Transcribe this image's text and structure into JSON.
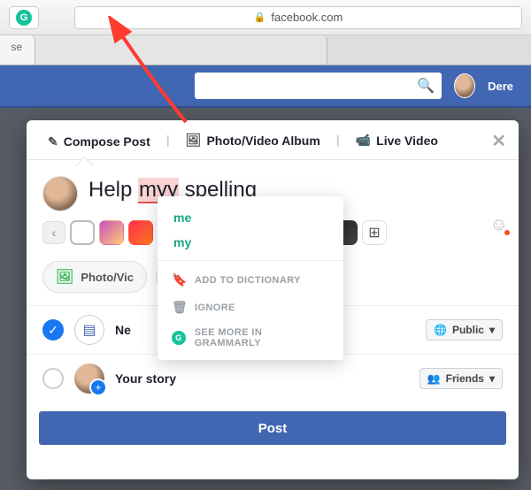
{
  "browser": {
    "url": "facebook.com",
    "extension": "G",
    "tab1_fragment": "se"
  },
  "fb": {
    "name": "Dere"
  },
  "modal_tabs": {
    "compose": "Compose Post",
    "album": "Photo/Video Album",
    "live": "Live Video"
  },
  "post": {
    "before": "Help ",
    "error": "myy",
    "after": " spelling"
  },
  "swatches": {
    "colors": [
      "#ffffff",
      "linear-gradient(135deg,#c850c0,#ffcc70)",
      "linear-gradient(135deg,#ff2d55,#ff7a18)",
      "#111",
      "#111",
      "linear-gradient(180deg,#ff6a00,#a60000)",
      "linear-gradient(135deg,#8e2de2,#e100ff)",
      "linear-gradient(180deg,#ff8a00,#ffd200)",
      "linear-gradient(135deg,#134e5e,#71b280)",
      "linear-gradient(135deg,#232526,#414345)"
    ]
  },
  "actions": {
    "photo": "Photo/Vic"
  },
  "audience": {
    "newsfeed": "Ne",
    "newsfeed_btn": "Public",
    "story": "Your story",
    "story_btn": "Friends"
  },
  "post_button": "Post",
  "grammarly": {
    "suggestions": [
      "me",
      "my"
    ],
    "add": "ADD TO DICTIONARY",
    "ignore": "IGNORE",
    "more": "SEE MORE IN GRAMMARLY"
  }
}
